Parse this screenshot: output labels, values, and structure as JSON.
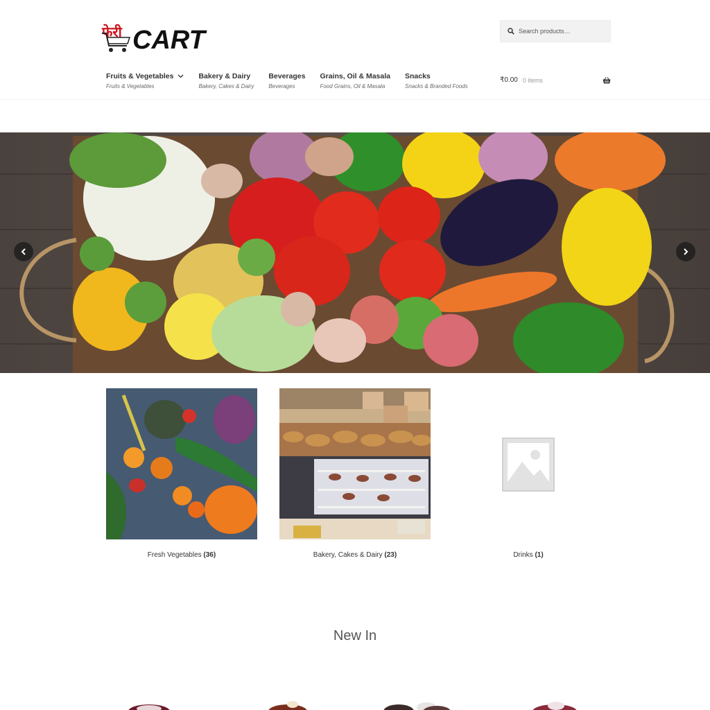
{
  "brand": {
    "hindi": "फेरी",
    "name": "CART",
    "accent": "#d0111b"
  },
  "search": {
    "placeholder": "Search products…",
    "icon": "search-icon"
  },
  "nav": {
    "items": [
      {
        "title": "Fruits & Vegetables",
        "sub": "Fruits & Vegetables",
        "has_dropdown": true
      },
      {
        "title": "Bakery & Dairy",
        "sub": "Bakery, Cakes & Dairy"
      },
      {
        "title": "Beverages",
        "sub": "Beverages"
      },
      {
        "title": "Grains, Oil & Masala",
        "sub": "Food Grains, Oil & Masala"
      },
      {
        "title": "Snacks",
        "sub": "Snacks & Branded Foods"
      }
    ]
  },
  "cart": {
    "amount": "₹0.00",
    "items": "0 items",
    "icon": "basket-icon"
  },
  "hero": {
    "prev_icon": "chevron-left-icon",
    "next_icon": "chevron-right-icon"
  },
  "categories": [
    {
      "name": "Fresh Vegetables",
      "count": "(36)"
    },
    {
      "name": "Bakery, Cakes & Dairy",
      "count": "(23)"
    },
    {
      "name": "Drinks",
      "count": "(1)"
    }
  ],
  "sections": {
    "new_in": "New In"
  }
}
